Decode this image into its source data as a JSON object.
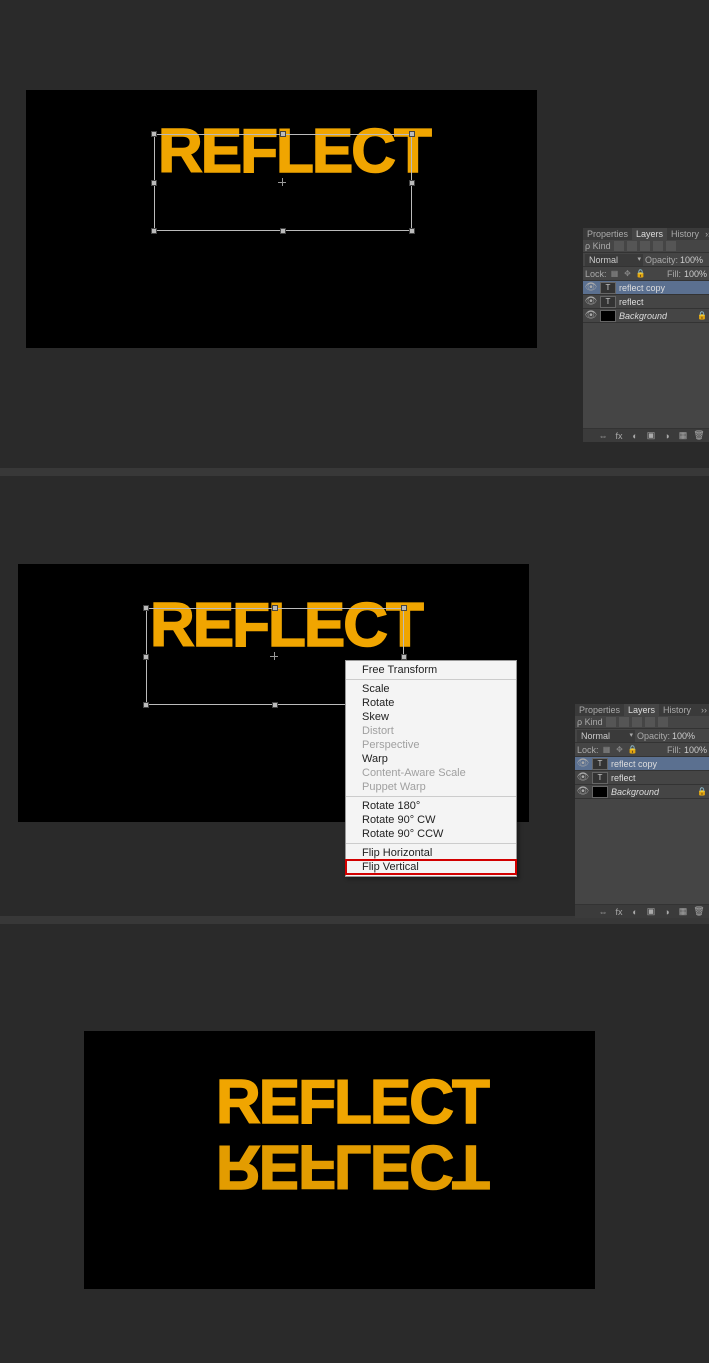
{
  "canvas_text": "REFLECT",
  "panels": {
    "tabs": {
      "properties": "Properties",
      "layers": "Layers",
      "history": "History"
    },
    "filter_label": "ρ Kind",
    "blend": "Normal",
    "opacity_label": "Opacity:",
    "opacity_value": "100%",
    "lock_label": "Lock:",
    "fill_label": "Fill:",
    "fill_value": "100%",
    "layers": [
      {
        "name": "reflect copy",
        "type": "T",
        "selected": true
      },
      {
        "name": "reflect",
        "type": "T",
        "selected": false
      },
      {
        "name": "Background",
        "type": "solid",
        "italic": true,
        "locked": true
      }
    ]
  },
  "context_menu": {
    "items": [
      {
        "label": "Free Transform",
        "enabled": true
      },
      {
        "sep": true
      },
      {
        "label": "Scale",
        "enabled": true
      },
      {
        "label": "Rotate",
        "enabled": true
      },
      {
        "label": "Skew",
        "enabled": true
      },
      {
        "label": "Distort",
        "enabled": false
      },
      {
        "label": "Perspective",
        "enabled": false
      },
      {
        "label": "Warp",
        "enabled": true
      },
      {
        "label": "Content-Aware Scale",
        "enabled": false
      },
      {
        "label": "Puppet Warp",
        "enabled": false
      },
      {
        "sep": true
      },
      {
        "label": "Rotate 180°",
        "enabled": true
      },
      {
        "label": "Rotate 90° CW",
        "enabled": true
      },
      {
        "label": "Rotate 90° CCW",
        "enabled": true
      },
      {
        "sep": true
      },
      {
        "label": "Flip Horizontal",
        "enabled": true
      },
      {
        "label": "Flip Vertical",
        "enabled": true,
        "highlight": true
      }
    ]
  }
}
